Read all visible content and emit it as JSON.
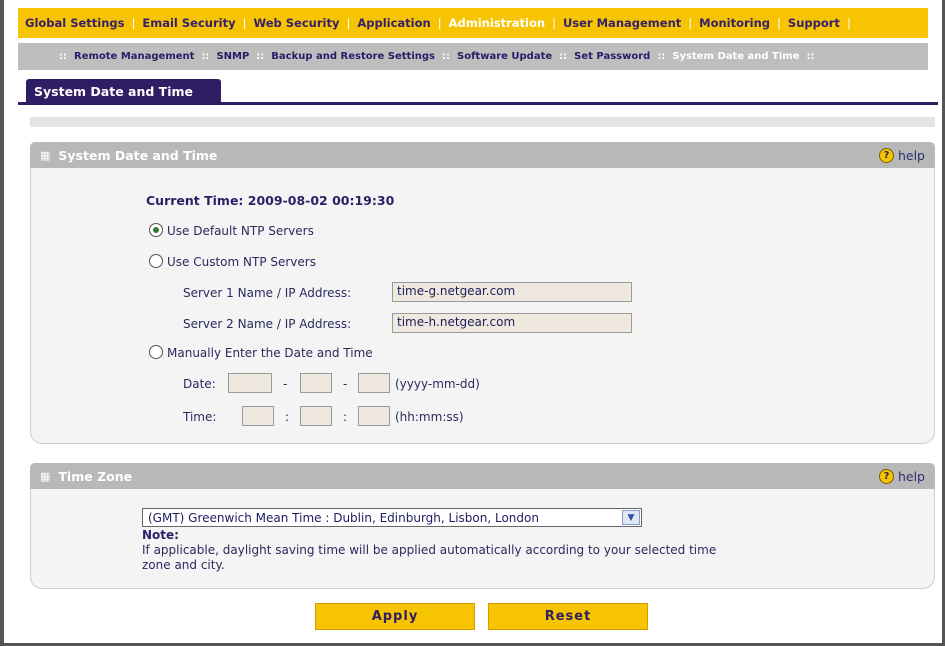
{
  "topnav": {
    "items": [
      {
        "label": "Global Settings"
      },
      {
        "label": "Email Security"
      },
      {
        "label": "Web Security"
      },
      {
        "label": "Application"
      },
      {
        "label": "Administration"
      },
      {
        "label": "User Management"
      },
      {
        "label": "Monitoring"
      },
      {
        "label": "Support"
      }
    ],
    "active": "Administration"
  },
  "subnav": {
    "items": [
      {
        "label": "Remote Management"
      },
      {
        "label": "SNMP"
      },
      {
        "label": "Backup and Restore Settings"
      },
      {
        "label": "Software Update"
      },
      {
        "label": "Set Password"
      },
      {
        "label": "System Date and Time"
      }
    ],
    "separator": "::"
  },
  "tab": {
    "label": "System Date and Time"
  },
  "date_section": {
    "title": "System Date and Time",
    "help": "help",
    "current_time_label": "Current Time: 2009-08-02 00:19:30",
    "opt_default": "Use Default NTP Servers",
    "opt_custom": "Use Custom NTP Servers",
    "server1_label": "Server 1 Name / IP Address:",
    "server1_value": "time-g.netgear.com",
    "server2_label": "Server 2 Name / IP Address:",
    "server2_value": "time-h.netgear.com",
    "opt_manual": "Manually Enter the Date and Time",
    "date_label": "Date:",
    "date_format": "(yyyy-mm-dd)",
    "date_sep": "-",
    "time_label": "Time:",
    "time_format": "(hh:mm:ss)",
    "time_sep": ":"
  },
  "tz_section": {
    "title": "Time Zone",
    "help": "help",
    "selected": "(GMT) Greenwich Mean Time : Dublin, Edinburgh, Lisbon, London",
    "note_label": "Note:",
    "note_line1": "If applicable, daylight saving time will be applied automatically according to your selected time",
    "note_line2": "zone and city."
  },
  "buttons": {
    "apply": "Apply",
    "reset": "Reset"
  },
  "colors": {
    "nav_yellow": "#f6c400",
    "nav_purple": "#2f1e63",
    "header_gray": "#b8b8b8"
  }
}
